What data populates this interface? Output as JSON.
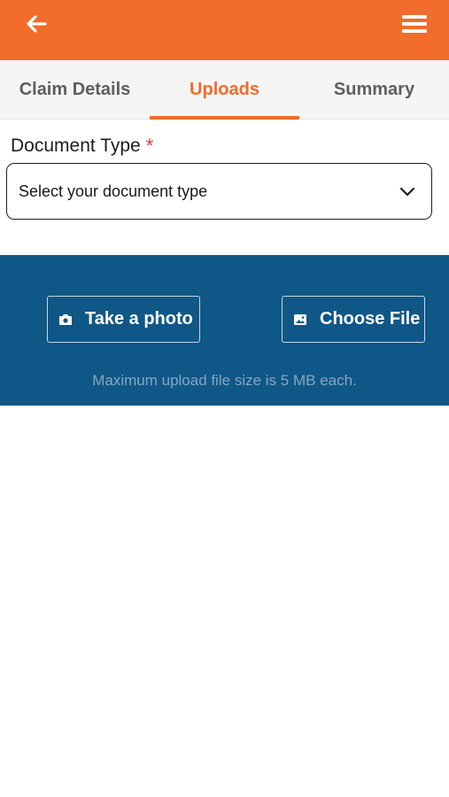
{
  "header": {
    "back_icon": "arrow-left-icon",
    "menu_icon": "hamburger-menu-icon",
    "background": "#f26c2b"
  },
  "tabs": [
    {
      "label": "Claim Details",
      "active": false
    },
    {
      "label": "Uploads",
      "active": true
    },
    {
      "label": "Summary",
      "active": false
    }
  ],
  "document_type": {
    "label": "Document Type",
    "required_marker": "*",
    "placeholder": "Select your document type"
  },
  "upload": {
    "take_photo_label": "Take a photo",
    "take_photo_icon": "camera-icon",
    "choose_file_label": "Choose File",
    "choose_file_icon": "image-icon",
    "note": "Maximum upload file size is 5 MB each.",
    "background": "#0f5787"
  }
}
